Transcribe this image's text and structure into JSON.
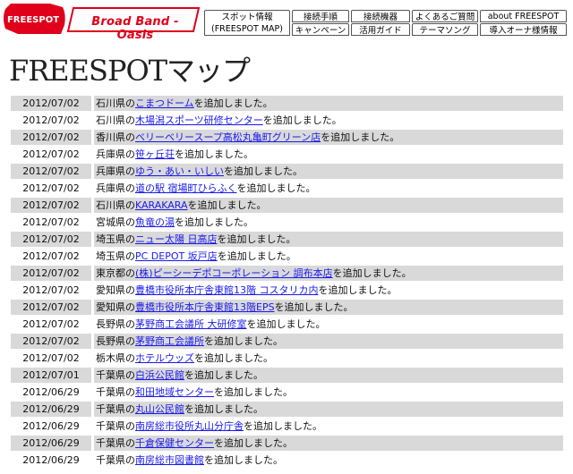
{
  "header": {
    "logo_text": "FREESPOT",
    "banner_text": "Broad Band - Oasis",
    "nav": [
      {
        "id": "spot-info",
        "lines": [
          "スポット情報",
          "(FREESPOT MAP)"
        ]
      },
      {
        "id": "connect-guide",
        "lines": [
          "接続手順"
        ]
      },
      {
        "id": "campaign",
        "lines": [
          "キャンペーン"
        ]
      },
      {
        "id": "devices",
        "lines": [
          "接続機器"
        ]
      },
      {
        "id": "usage-guide",
        "lines": [
          "活用ガイド"
        ]
      },
      {
        "id": "faq",
        "lines": [
          "よくあるご質問"
        ]
      },
      {
        "id": "theme-song",
        "lines": [
          "テーマソング"
        ]
      },
      {
        "id": "about",
        "lines": [
          "about FREESPOT"
        ]
      },
      {
        "id": "owner-info",
        "lines": [
          "導入オーナ様情報"
        ]
      }
    ]
  },
  "page_title": "FREESPOTマップ",
  "entries": [
    {
      "date": "2012/07/02",
      "pref": "石川県の",
      "name": "こまつドーム",
      "suffix": "を追加しました。"
    },
    {
      "date": "2012/07/02",
      "pref": "石川県の",
      "name": "木場潟スポーツ研修センター",
      "suffix": "を追加しました。"
    },
    {
      "date": "2012/07/02",
      "pref": "香川県の",
      "name": "ベリーベリースープ高松丸亀町グリーン店",
      "suffix": "を追加しました。"
    },
    {
      "date": "2012/07/02",
      "pref": "兵庫県の",
      "name": "笹ヶ丘荘",
      "suffix": "を追加しました。"
    },
    {
      "date": "2012/07/02",
      "pref": "兵庫県の",
      "name": "ゆう・あい・いしい",
      "suffix": "を追加しました。"
    },
    {
      "date": "2012/07/02",
      "pref": "兵庫県の",
      "name": "道の駅 宿場町ひらふく",
      "suffix": "を追加しました。"
    },
    {
      "date": "2012/07/02",
      "pref": "石川県の",
      "name": "KARAKARA",
      "suffix": "を追加しました。"
    },
    {
      "date": "2012/07/02",
      "pref": "宮城県の",
      "name": "魚竜の湯",
      "suffix": "を追加しました。"
    },
    {
      "date": "2012/07/02",
      "pref": "埼玉県の",
      "name": "ニュー太陽 日高店",
      "suffix": "を追加しました。"
    },
    {
      "date": "2012/07/02",
      "pref": "埼玉県の",
      "name": "PC DEPOT 坂戸店",
      "suffix": "を追加しました。"
    },
    {
      "date": "2012/07/02",
      "pref": "東京都の",
      "name": "(株)ピーシーデポコーポレーション 調布本店",
      "suffix": "を追加しました。"
    },
    {
      "date": "2012/07/02",
      "pref": "愛知県の",
      "name": "豊橋市役所本庁舎東館13階 コスタリカ内",
      "suffix": "を追加しました。"
    },
    {
      "date": "2012/07/02",
      "pref": "愛知県の",
      "name": "豊橋市役所本庁舎東館13階EPS",
      "suffix": "を追加しました。"
    },
    {
      "date": "2012/07/02",
      "pref": "長野県の",
      "name": "茅野商工会議所 大研修室",
      "suffix": "を追加しました。"
    },
    {
      "date": "2012/07/02",
      "pref": "長野県の",
      "name": "茅野商工会議所",
      "suffix": "を追加しました。"
    },
    {
      "date": "2012/07/02",
      "pref": "栃木県の",
      "name": "ホテルウッズ",
      "suffix": "を追加しました。"
    },
    {
      "date": "2012/07/01",
      "pref": "千葉県の",
      "name": "白浜公民館",
      "suffix": "を追加しました。"
    },
    {
      "date": "2012/06/29",
      "pref": "千葉県の",
      "name": "和田地域センター",
      "suffix": "を追加しました。"
    },
    {
      "date": "2012/06/29",
      "pref": "千葉県の",
      "name": "丸山公民館",
      "suffix": "を追加しました。"
    },
    {
      "date": "2012/06/29",
      "pref": "千葉県の",
      "name": "南房総市役所丸山分庁舎",
      "suffix": "を追加しました。"
    },
    {
      "date": "2012/06/29",
      "pref": "千葉県の",
      "name": "千倉保健センター",
      "suffix": "を追加しました。"
    },
    {
      "date": "2012/06/29",
      "pref": "千葉県の",
      "name": "南房総市図書館",
      "suffix": "を追加しました。"
    }
  ],
  "colors": {
    "brand_red": "#e0001b",
    "link": "#1a1aee",
    "row_alt": "#d9d9d9"
  }
}
